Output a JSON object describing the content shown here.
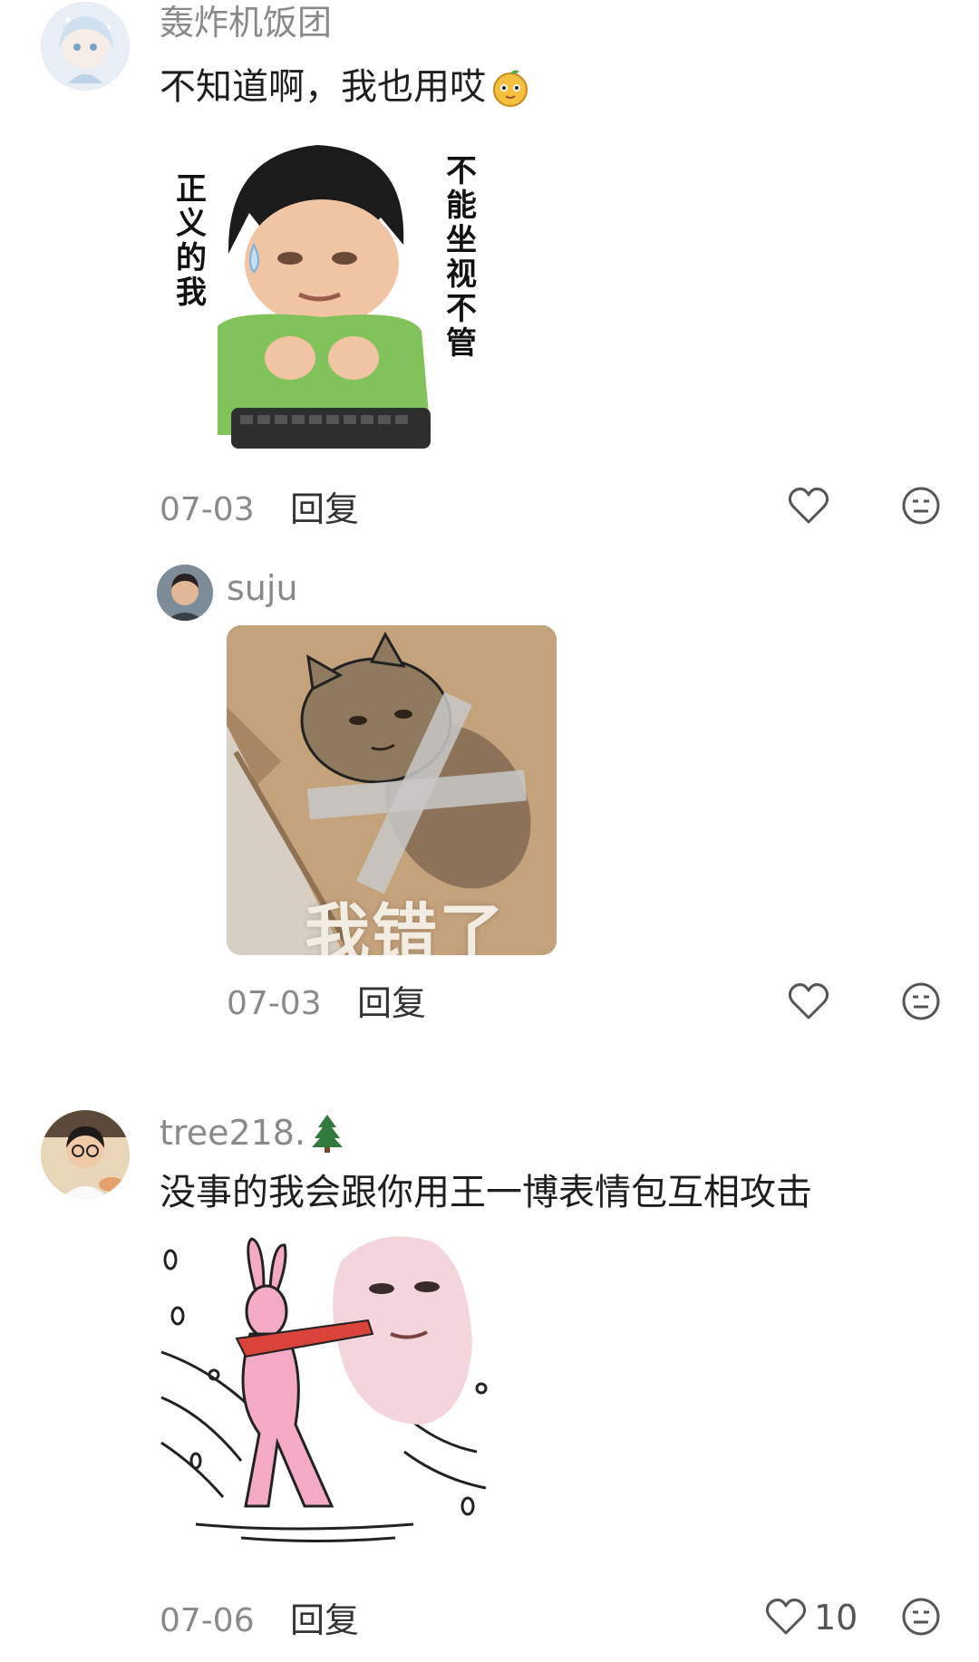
{
  "comments": [
    {
      "username": "轰炸机饭团",
      "text": "不知道啊，我也用哎",
      "sticker_left_text": "正义的我",
      "sticker_right_text": "不能坐视不管",
      "date": "07-03",
      "reply_label": "回复",
      "like_count": ""
    },
    {
      "username": "suju",
      "sticker_text": "我错了",
      "date": "07-03",
      "reply_label": "回复",
      "like_count": ""
    },
    {
      "username": "tree218.",
      "text": "没事的我会跟你用王一博表情包互相攻击",
      "date": "07-06",
      "reply_label": "回复",
      "like_count": "10"
    }
  ],
  "colors": {
    "username": "#8a8a8a",
    "text": "#1e1e1e",
    "icon": "#555555",
    "background": "#ffffff"
  },
  "icons": [
    "heart-icon",
    "emoji-react-icon",
    "tree-emoji-icon",
    "orange-emoji-icon"
  ]
}
